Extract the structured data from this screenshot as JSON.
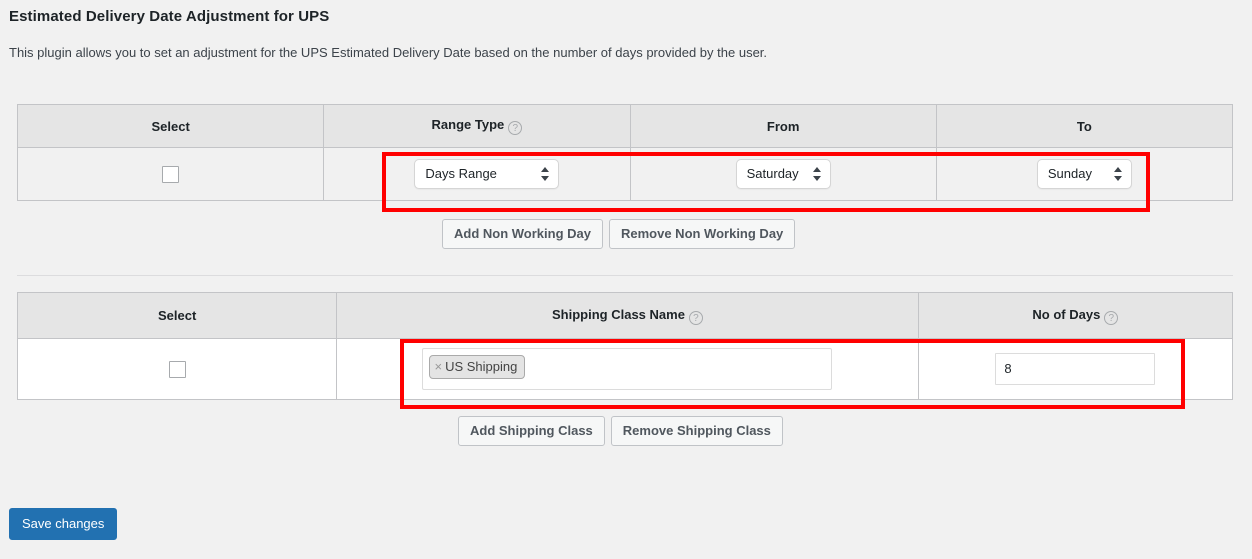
{
  "header": {
    "title": "Estimated Delivery Date Adjustment for UPS",
    "description": "This plugin allows you to set an adjustment for the UPS Estimated Delivery Date based on the number of days provided by the user."
  },
  "non_working_days_table": {
    "columns": [
      {
        "label": "Select",
        "help": false
      },
      {
        "label": "Range Type",
        "help": true,
        "help_glyph": "?"
      },
      {
        "label": "From",
        "help": false
      },
      {
        "label": "To",
        "help": false
      }
    ],
    "rows": [
      {
        "selected": false,
        "range_type": "Days Range",
        "from": "Saturday",
        "to": "Sunday"
      }
    ],
    "buttons": {
      "add": "Add Non Working Day",
      "remove": "Remove Non Working Day"
    }
  },
  "shipping_class_table": {
    "columns": [
      {
        "label": "Select",
        "help": false
      },
      {
        "label": "Shipping Class Name",
        "help": true,
        "help_glyph": "?"
      },
      {
        "label": "No of Days",
        "help": true,
        "help_glyph": "?"
      }
    ],
    "rows": [
      {
        "selected": false,
        "shipping_classes": [
          {
            "label": "US Shipping",
            "remove_glyph": "×"
          }
        ],
        "no_of_days": "8"
      }
    ],
    "buttons": {
      "add": "Add Shipping Class",
      "remove": "Remove Shipping Class"
    }
  },
  "footer": {
    "save_label": "Save changes"
  },
  "colors": {
    "primary_button": "#2271b1",
    "annotation": "#ff0000",
    "table_header_bg": "#e5e5e5",
    "page_bg": "#f1f1f1"
  }
}
